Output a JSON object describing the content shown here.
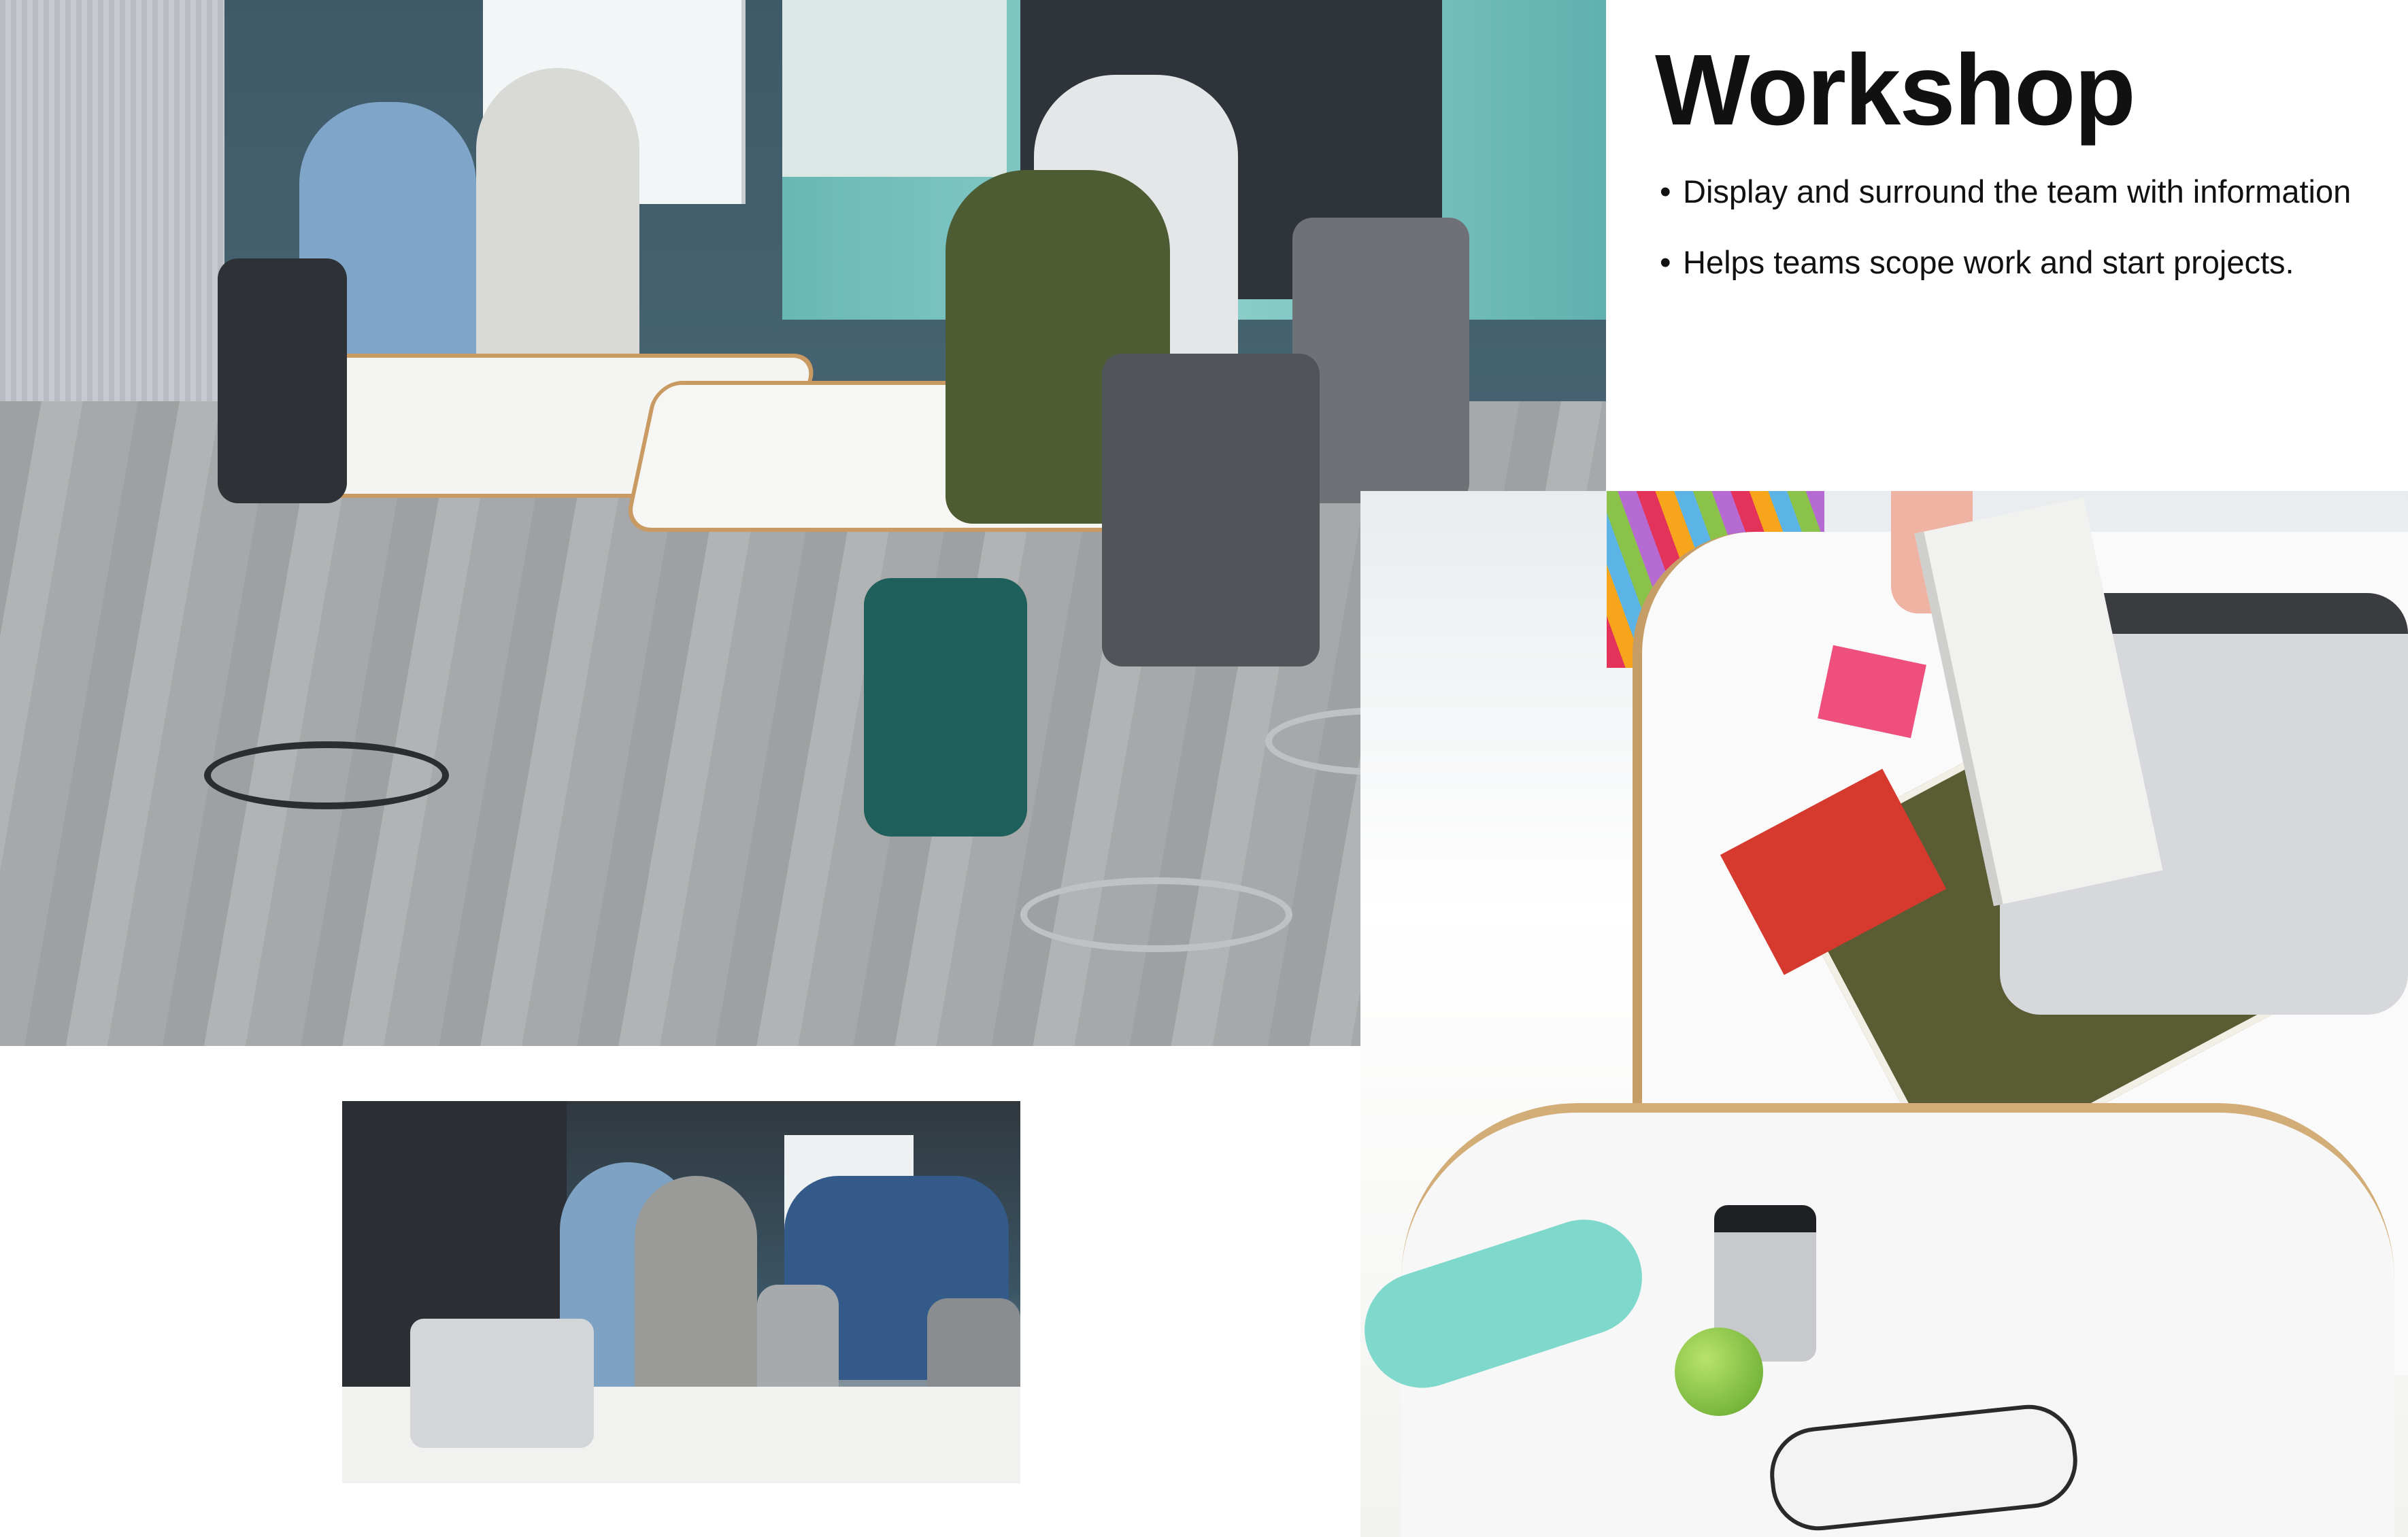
{
  "header": {
    "title": "Workshop"
  },
  "bullets": [
    "Display and surround the team with information",
    "Helps teams scope work and start projects."
  ],
  "photos": {
    "main": "photo-workshop-team",
    "detail": "photo-desk-detail",
    "small": "photo-team-overview"
  }
}
